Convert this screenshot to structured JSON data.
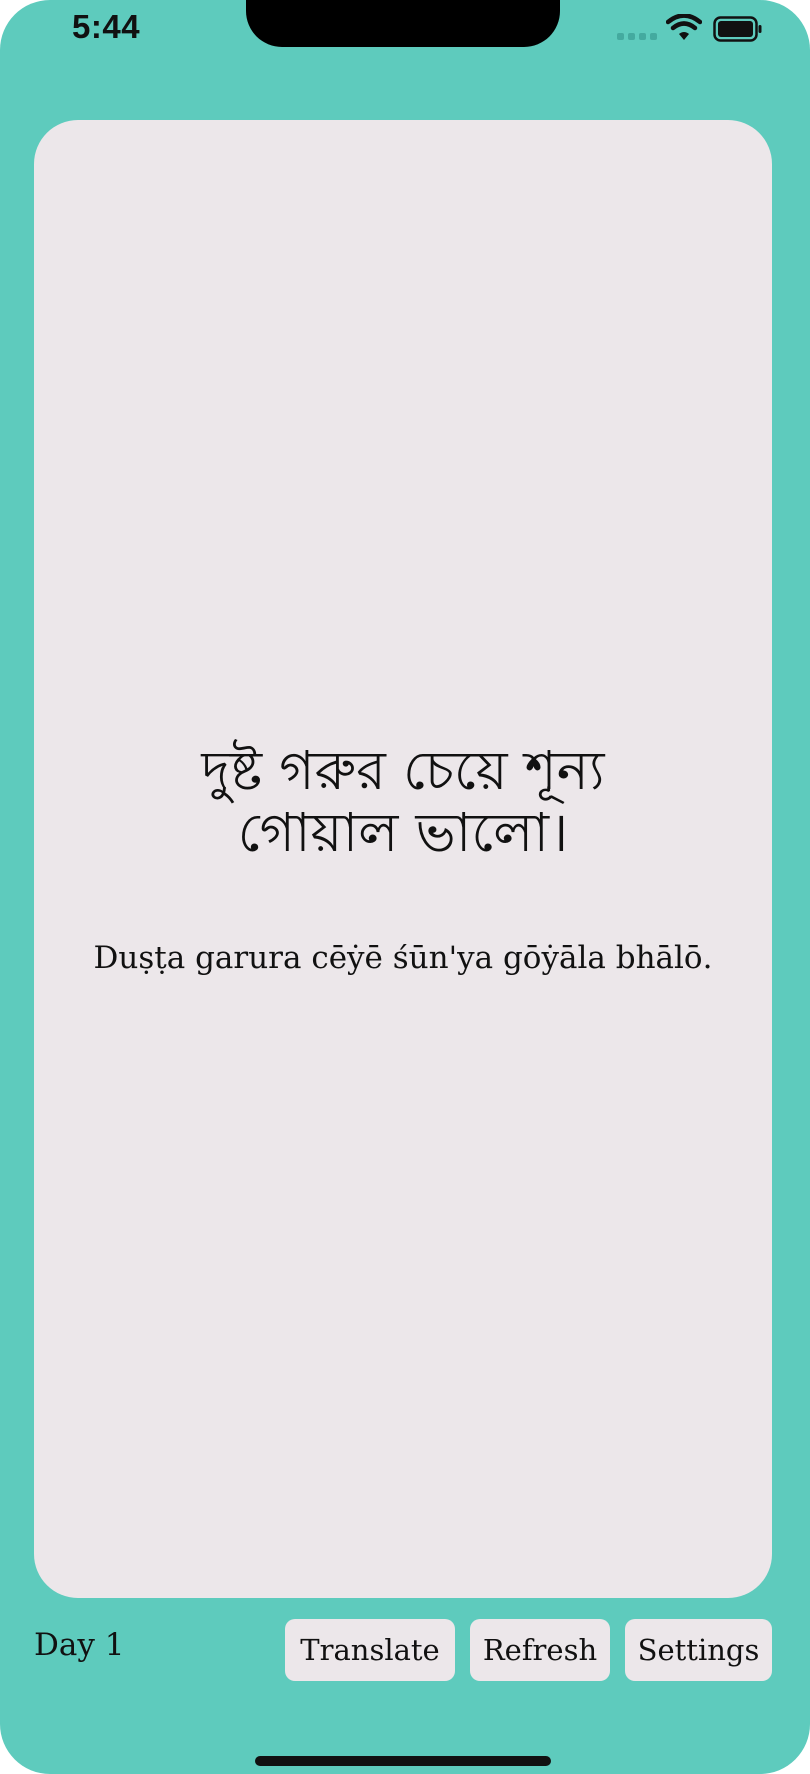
{
  "status_bar": {
    "time": "5:44"
  },
  "card": {
    "bengali_text": "দুষ্ট গরুর চেয়ে শূন্য গোয়াল ভালো।",
    "transliteration": "Duṣṭa garura cēẏē śūn'ya gōẏāla bhālō."
  },
  "footer": {
    "day_label": "Day 1",
    "buttons": {
      "translate": "Translate",
      "refresh": "Refresh",
      "settings": "Settings"
    }
  },
  "colors": {
    "background": "#5ecbbd",
    "card": "#ece7ea",
    "text": "#111111"
  },
  "icons": [
    "cellular-signal-icon",
    "wifi-icon",
    "battery-icon"
  ]
}
